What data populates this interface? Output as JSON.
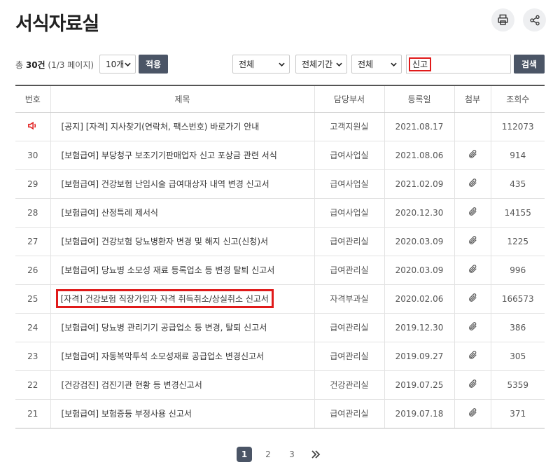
{
  "page": {
    "title": "서식자료실"
  },
  "toolbar": {
    "total_prefix": "총 ",
    "total_count": "30건",
    "total_pages": " (1/3 페이지)",
    "per_page": "10개",
    "apply_label": "적용",
    "filter1": "전체",
    "filter2": "전체기간",
    "filter3": "전체",
    "search_value": "신고",
    "search_label": "검색"
  },
  "table": {
    "headers": [
      "번호",
      "제목",
      "담당부서",
      "등록일",
      "첨부",
      "조회수"
    ],
    "rows": [
      {
        "no": "",
        "notice": true,
        "title": "[공지] [자격] 지사찾기(연락처, 팩스번호) 바로가기 안내",
        "dept": "고객지원실",
        "date": "2021.08.17",
        "attach": false,
        "views": "112073"
      },
      {
        "no": "30",
        "title": "[보험급여] 부당청구 보조기기판매업자 신고 포상금 관련 서식",
        "dept": "급여사업실",
        "date": "2021.08.06",
        "attach": true,
        "views": "914"
      },
      {
        "no": "29",
        "title": "[보험급여] 건강보험 난임시술 급여대상자 내역 변경 신고서",
        "dept": "급여사업실",
        "date": "2021.02.09",
        "attach": true,
        "views": "435"
      },
      {
        "no": "28",
        "title": "[보험급여] 산정특례 제서식",
        "dept": "급여사업실",
        "date": "2020.12.30",
        "attach": true,
        "views": "14155"
      },
      {
        "no": "27",
        "title": "[보험급여] 건강보험 당뇨병환자 변경 및 해지 신고(신청)서",
        "dept": "급여관리실",
        "date": "2020.03.09",
        "attach": true,
        "views": "1225"
      },
      {
        "no": "26",
        "title": "[보험급여] 당뇨병 소모성 재료 등록업소 등 변경 탈퇴 신고서",
        "dept": "급여관리실",
        "date": "2020.03.09",
        "attach": true,
        "views": "996"
      },
      {
        "no": "25",
        "highlight": true,
        "title": "[자격] 건강보험 직장가입자 자격 취득취소/상실취소 신고서",
        "dept": "자격부과실",
        "date": "2020.02.06",
        "attach": true,
        "views": "166573"
      },
      {
        "no": "24",
        "title": "[보험급여] 당뇨병 관리기기 공급업소 등 변경, 탈퇴 신고서",
        "dept": "급여관리실",
        "date": "2019.12.30",
        "attach": true,
        "views": "386"
      },
      {
        "no": "23",
        "title": "[보험급여] 자동복막투석 소모성재료 공급업소 변경신고서",
        "dept": "급여관리실",
        "date": "2019.09.27",
        "attach": true,
        "views": "305"
      },
      {
        "no": "22",
        "title": "[건강검진] 검진기관 현황 등 변경신고서",
        "dept": "건강관리실",
        "date": "2019.07.25",
        "attach": true,
        "views": "5359"
      },
      {
        "no": "21",
        "title": "[보험급여] 보험증등 부정사용 신고서",
        "dept": "급여관리실",
        "date": "2019.07.18",
        "attach": true,
        "views": "371"
      }
    ]
  },
  "pagination": {
    "pages": [
      "1",
      "2",
      "3"
    ],
    "current": "1"
  },
  "colors": {
    "accent": "#4b5566",
    "highlight": "#e01a1a",
    "notice": "#e01a1a"
  },
  "icons": {
    "print": "printer-icon",
    "share": "share-icon",
    "notice": "megaphone-icon",
    "attach": "paperclip-icon",
    "next": "double-chevron-right-icon"
  }
}
